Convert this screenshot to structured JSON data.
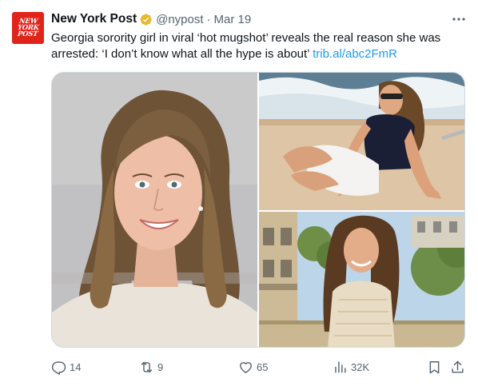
{
  "account": {
    "avatar_lines": [
      "NEW",
      "YORK",
      "POST"
    ],
    "name": "New York Post",
    "verified_badge": "gold-checkmark",
    "handle": "@nypost",
    "separator": "·",
    "date": "Mar 19"
  },
  "tweet": {
    "text": "Georgia sorority girl in viral ‘hot mugshot’ reveals the real reason she was arrested: ‘I don’t know what all the hype is about’",
    "link": "trib.al/abc2FmR"
  },
  "more_icon": "more-horizontal-icon",
  "media": {
    "images": [
      {
        "name": "mugshot-photo",
        "description_icon": "photo"
      },
      {
        "name": "boat-photo",
        "description_icon": "photo"
      },
      {
        "name": "paris-photo",
        "description_icon": "photo"
      }
    ]
  },
  "actions": {
    "replies": "14",
    "retweets": "9",
    "likes": "65",
    "views": "32K"
  },
  "colors": {
    "text": "#0f1419",
    "secondary": "#536471",
    "link": "#1d9bf0",
    "border": "#cfd9de",
    "brand": "#e2231a",
    "badge": "#e8b829"
  }
}
